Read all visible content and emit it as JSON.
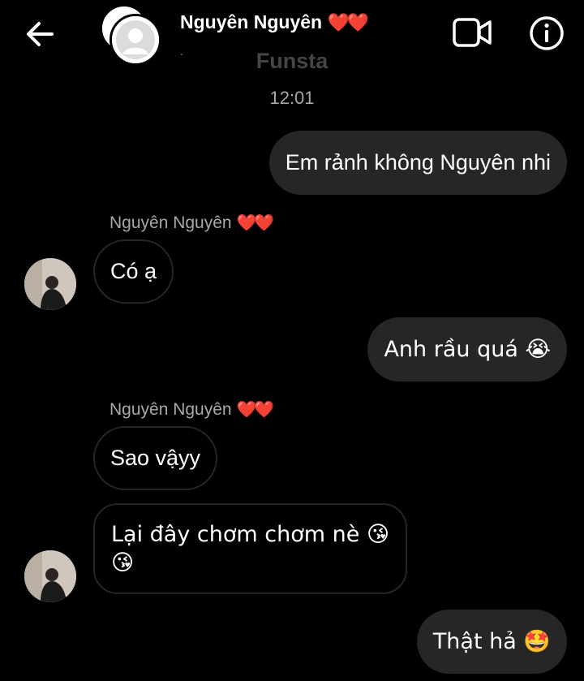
{
  "header": {
    "back_icon": "arrow-left-icon",
    "contact_name": "Nguyên Nguyên",
    "contact_hearts": "❤️❤️",
    "status_dot": ".",
    "subtitle": "Funsta",
    "video_icon": "video-camera-icon",
    "info_icon": "info-icon"
  },
  "conversation": {
    "timestamp": "12:01",
    "sender_name": "Nguyên Nguyên",
    "sender_hearts": "❤️❤️",
    "messages": [
      {
        "side": "sent",
        "text": "Em rảnh không Nguyên nhi"
      },
      {
        "side": "received",
        "text": "Có ạ"
      },
      {
        "side": "sent",
        "text": "Anh rầu quá 😭"
      },
      {
        "side": "received",
        "text": "Sao vậyy"
      },
      {
        "side": "received",
        "line1": "Lại đây chơm chơm nè 😘",
        "line2": "😘"
      },
      {
        "side": "sent",
        "text": "Thật hả 🤩"
      }
    ]
  },
  "colors": {
    "background": "#000000",
    "sent_bubble": "#262626",
    "received_border": "#262626",
    "muted_text": "#a8a8a8",
    "heart": "#e0242b"
  }
}
